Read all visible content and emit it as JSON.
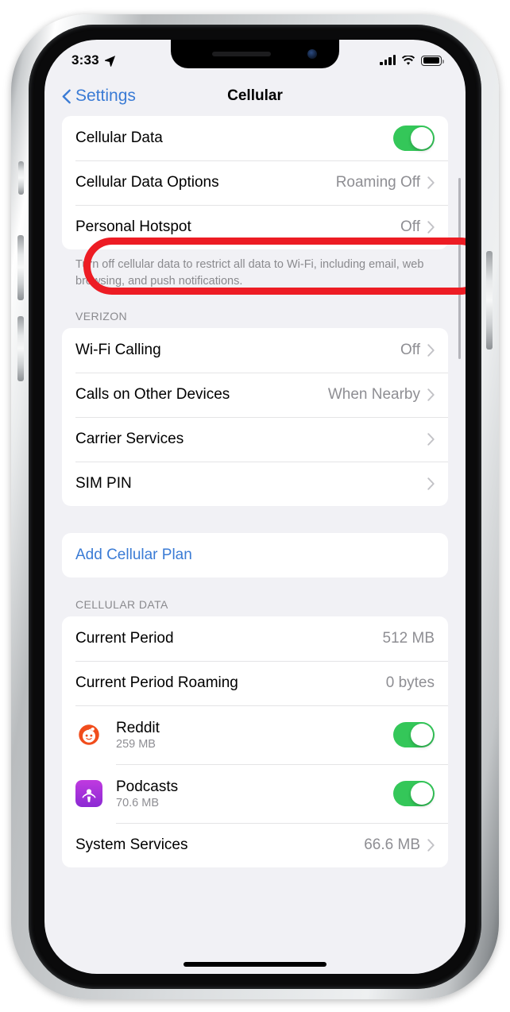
{
  "device": {
    "name": "iphone-x"
  },
  "status_bar": {
    "time": "3:33",
    "location_icon": "location-arrow-icon",
    "signal_icon": "cellular-bars-icon",
    "wifi_icon": "wifi-icon",
    "battery_icon": "battery-icon"
  },
  "nav": {
    "back_label": "Settings",
    "back_icon": "chevron-left-icon",
    "title": "Cellular"
  },
  "group_data": {
    "rows": [
      {
        "label": "Cellular Data",
        "control": "toggle",
        "toggle_on": true
      },
      {
        "label": "Cellular Data Options",
        "value": "Roaming Off",
        "control": "chevron"
      },
      {
        "label": "Personal Hotspot",
        "value": "Off",
        "control": "chevron"
      }
    ],
    "footer": "Turn off cellular data to restrict all data to Wi-Fi, including email, web browsing, and push notifications."
  },
  "group_carrier": {
    "header": "VERIZON",
    "rows": [
      {
        "label": "Wi-Fi Calling",
        "value": "Off",
        "control": "chevron"
      },
      {
        "label": "Calls on Other Devices",
        "value": "When Nearby",
        "control": "chevron"
      },
      {
        "label": "Carrier Services",
        "value": "",
        "control": "chevron"
      },
      {
        "label": "SIM PIN",
        "value": "",
        "control": "chevron"
      }
    ]
  },
  "group_plan": {
    "rows": [
      {
        "label": "Add Cellular Plan",
        "link": true
      }
    ]
  },
  "group_usage": {
    "header": "CELLULAR DATA",
    "rows": [
      {
        "label": "Current Period",
        "value": "512 MB",
        "control": "none"
      },
      {
        "label": "Current Period Roaming",
        "value": "0 bytes",
        "control": "none"
      }
    ],
    "apps": [
      {
        "name": "Reddit",
        "usage": "259 MB",
        "icon": "reddit-app-icon",
        "toggle_on": true
      },
      {
        "name": "Podcasts",
        "usage": "70.6 MB",
        "icon": "podcasts-app-icon",
        "toggle_on": true
      }
    ],
    "system_row": {
      "label": "System Services",
      "value": "66.6 MB",
      "control": "chevron"
    }
  },
  "annotation": {
    "shape": "ellipse",
    "color": "#ED1C24",
    "target": "Cellular Data Options"
  },
  "colors": {
    "accent_blue": "#3A7BD5",
    "toggle_green": "#34C759",
    "value_gray": "#8E8E93",
    "background": "#F1F1F5",
    "annotation_red": "#ED1C24"
  }
}
